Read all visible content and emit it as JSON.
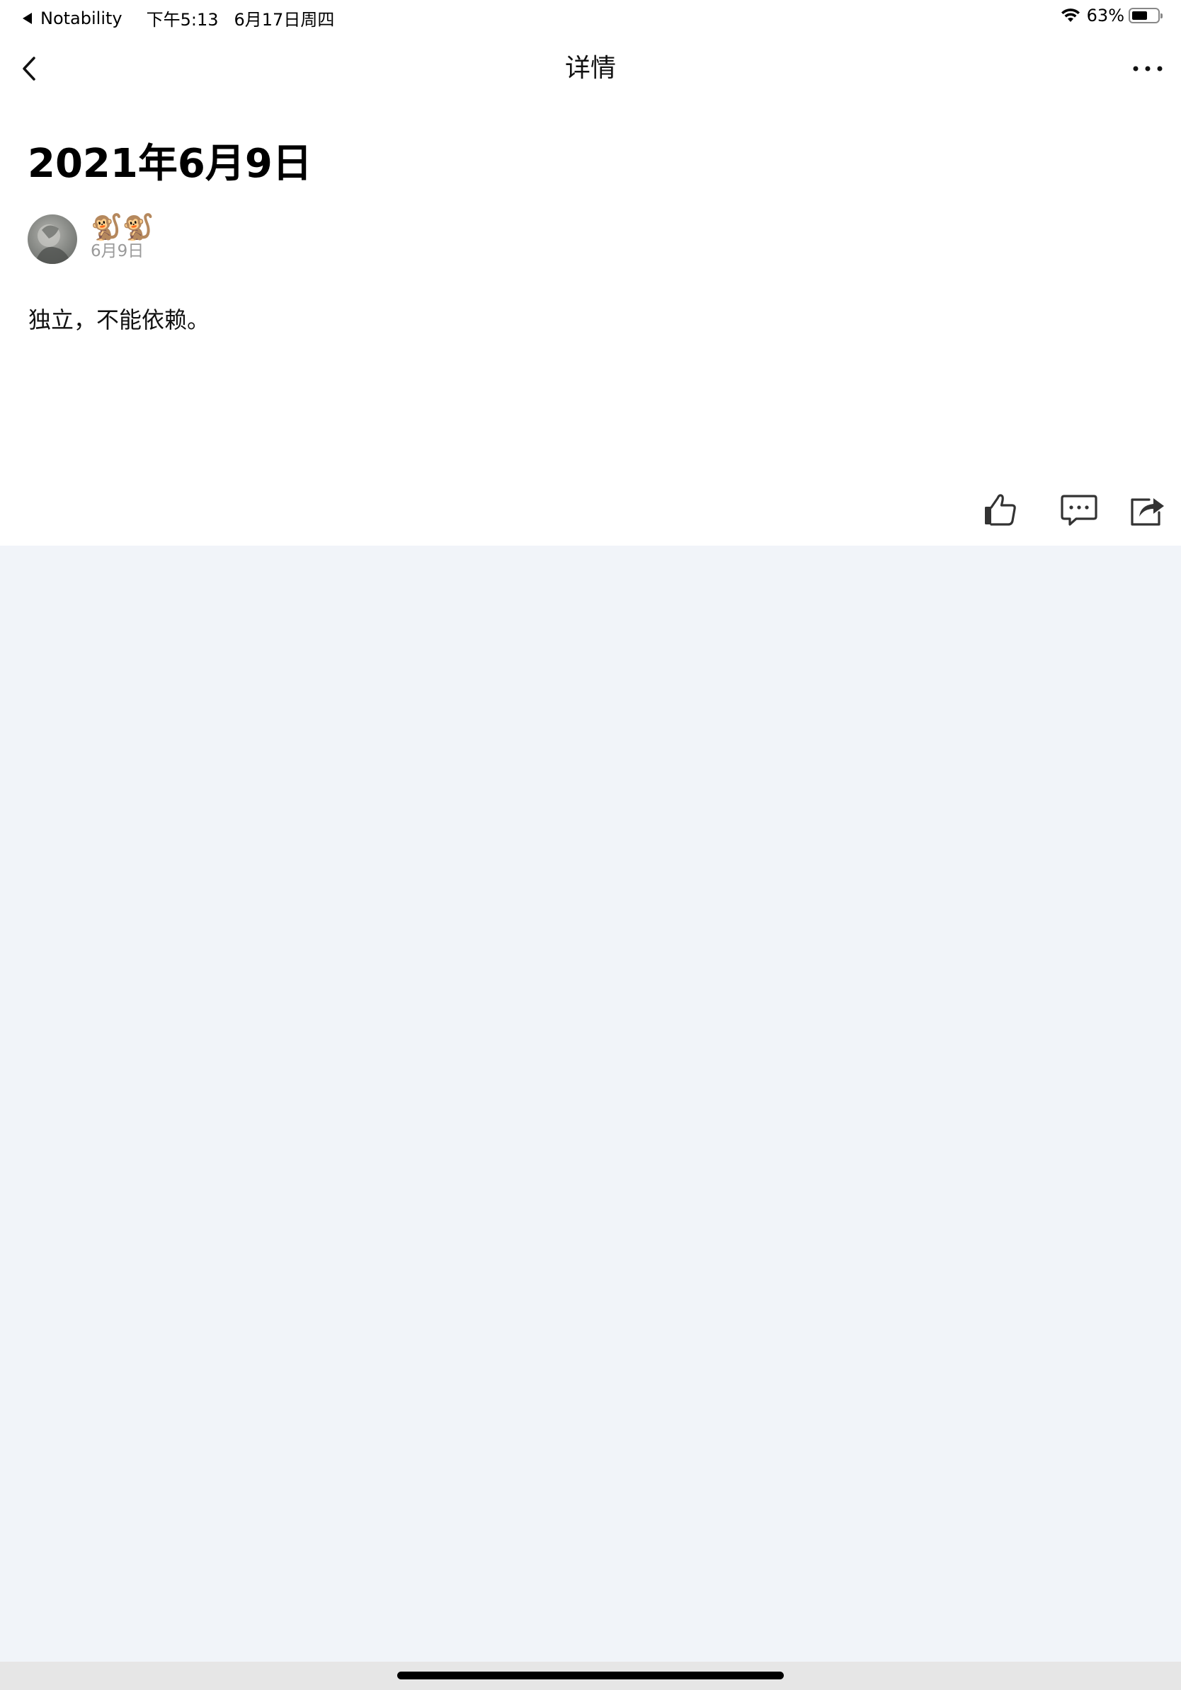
{
  "status_bar": {
    "back_app": "Notability",
    "time": "下午5:13",
    "date": "6月17日周四",
    "battery_text": "63%",
    "battery_level": 0.63
  },
  "nav": {
    "title": "详情"
  },
  "post": {
    "title": "2021年6月9日",
    "author": "🐒🐒",
    "date": "6月9日",
    "body": "独立，不能依赖。"
  },
  "icons": {
    "back": "chevron-left-icon",
    "more": "more-horizontal-icon",
    "like": "thumbs-up-icon",
    "comment": "comment-icon",
    "share": "share-icon",
    "wifi": "wifi-icon",
    "battery": "battery-icon"
  },
  "colors": {
    "page_background": "#f1f4f9",
    "content_background": "#ffffff",
    "secondary_text": "#9a9a9a"
  }
}
